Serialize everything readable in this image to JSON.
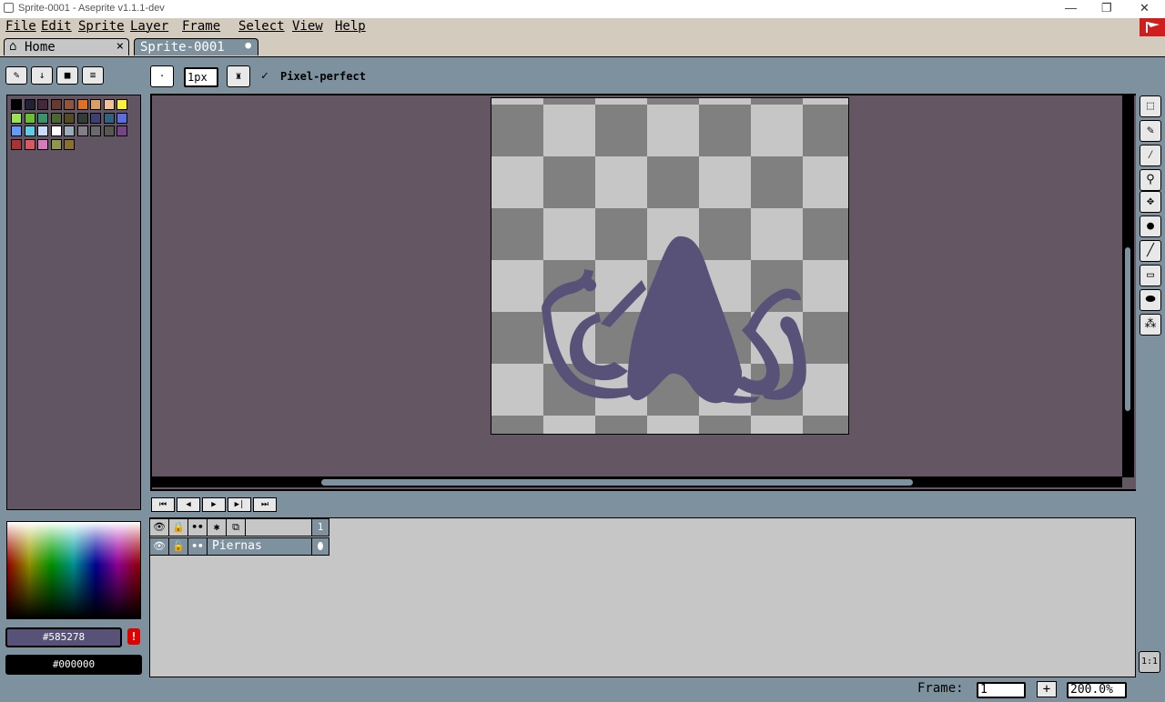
{
  "window": {
    "title": "Sprite-0001 - Aseprite v1.1.1-dev",
    "minimize": "—",
    "restore": "❐",
    "close": "✕"
  },
  "menu": [
    "File",
    "Edit",
    "Sprite",
    "Layer",
    "Frame",
    "Select",
    "View",
    "Help"
  ],
  "tabs": {
    "home": "Home",
    "home_close": "×",
    "sprite": "Sprite-0001",
    "sprite_modified": "●"
  },
  "context_bar": {
    "brush_size": "1px",
    "pixel_perfect_label": "Pixel-perfect",
    "pixel_perfect_checked": true
  },
  "palette": {
    "colors": [
      "#000000",
      "#222034",
      "#45283c",
      "#663931",
      "#8f563b",
      "#df7126",
      "#d9a066",
      "#eec39a",
      "#fbf236",
      "#99e550",
      "#6abe30",
      "#37946e",
      "#4b692f",
      "#524b24",
      "#323c39",
      "#3f3f74",
      "#306082",
      "#5b6ee1",
      "#639bff",
      "#5fcde4",
      "#cbdbfc",
      "#ffffff",
      "#9badb7",
      "#847e87",
      "#696a6a",
      "#595652",
      "#76428a",
      "#ac3232",
      "#d95763",
      "#d77bba",
      "#8f974a",
      "#8a6f30"
    ]
  },
  "colors": {
    "foreground_hex": "#585278",
    "background_hex": "#000000",
    "foreground_color": "#585278",
    "background_color": "#000000",
    "accent": "#d01e1e"
  },
  "playback": [
    "⏮",
    "◀",
    "▶",
    "▶|",
    "⏭"
  ],
  "timeline": {
    "header_icons": [
      "eye-icon",
      "lock-icon",
      "link-icon",
      "gear-icon",
      "onion-icon"
    ],
    "frames": [
      "1"
    ],
    "layers": [
      {
        "name": "Piernas",
        "cel": "⬮"
      }
    ]
  },
  "status": {
    "frame_label": "Frame:",
    "frame_value": "1",
    "add_frame": "+",
    "zoom": "200.0%",
    "zoom_reset": "1:1"
  }
}
